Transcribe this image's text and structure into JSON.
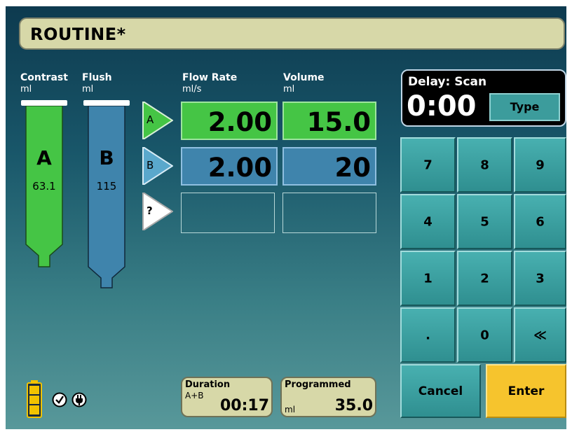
{
  "protocol": {
    "title": "ROUTINE*"
  },
  "syringes": {
    "contrast": {
      "header": "Contrast",
      "unit": "ml",
      "letter": "A",
      "volume": "63.1",
      "color": "#45c545"
    },
    "flush": {
      "header": "Flush",
      "unit": "ml",
      "letter": "B",
      "volume": "115",
      "color": "#3f84ac"
    }
  },
  "phase_table": {
    "flow_rate_header": "Flow Rate",
    "flow_rate_unit": "ml/s",
    "volume_header": "Volume",
    "volume_unit": "ml",
    "phases": [
      {
        "indicator": "A",
        "flow_rate": "2.00",
        "volume": "15.0"
      },
      {
        "indicator": "B",
        "flow_rate": "2.00",
        "volume": "20"
      },
      {
        "indicator": "?",
        "flow_rate": "",
        "volume": ""
      }
    ]
  },
  "delay": {
    "label": "Delay: Scan",
    "time": "0:00",
    "type_button": "Type"
  },
  "keypad": {
    "keys": [
      "7",
      "8",
      "9",
      "4",
      "5",
      "6",
      "1",
      "2",
      "3",
      ".",
      "0",
      "≪"
    ],
    "cancel": "Cancel",
    "enter": "Enter",
    "enter_color": "#f6c42d"
  },
  "status": {
    "battery_icon": "battery-icon",
    "check_icon": "checkmark-circle-icon",
    "power_icon": "power-plug-icon"
  },
  "duration": {
    "label": "Duration",
    "sub": "A+B",
    "value": "00:17"
  },
  "programmed": {
    "label": "Programmed",
    "unit": "ml",
    "value": "35.0"
  }
}
